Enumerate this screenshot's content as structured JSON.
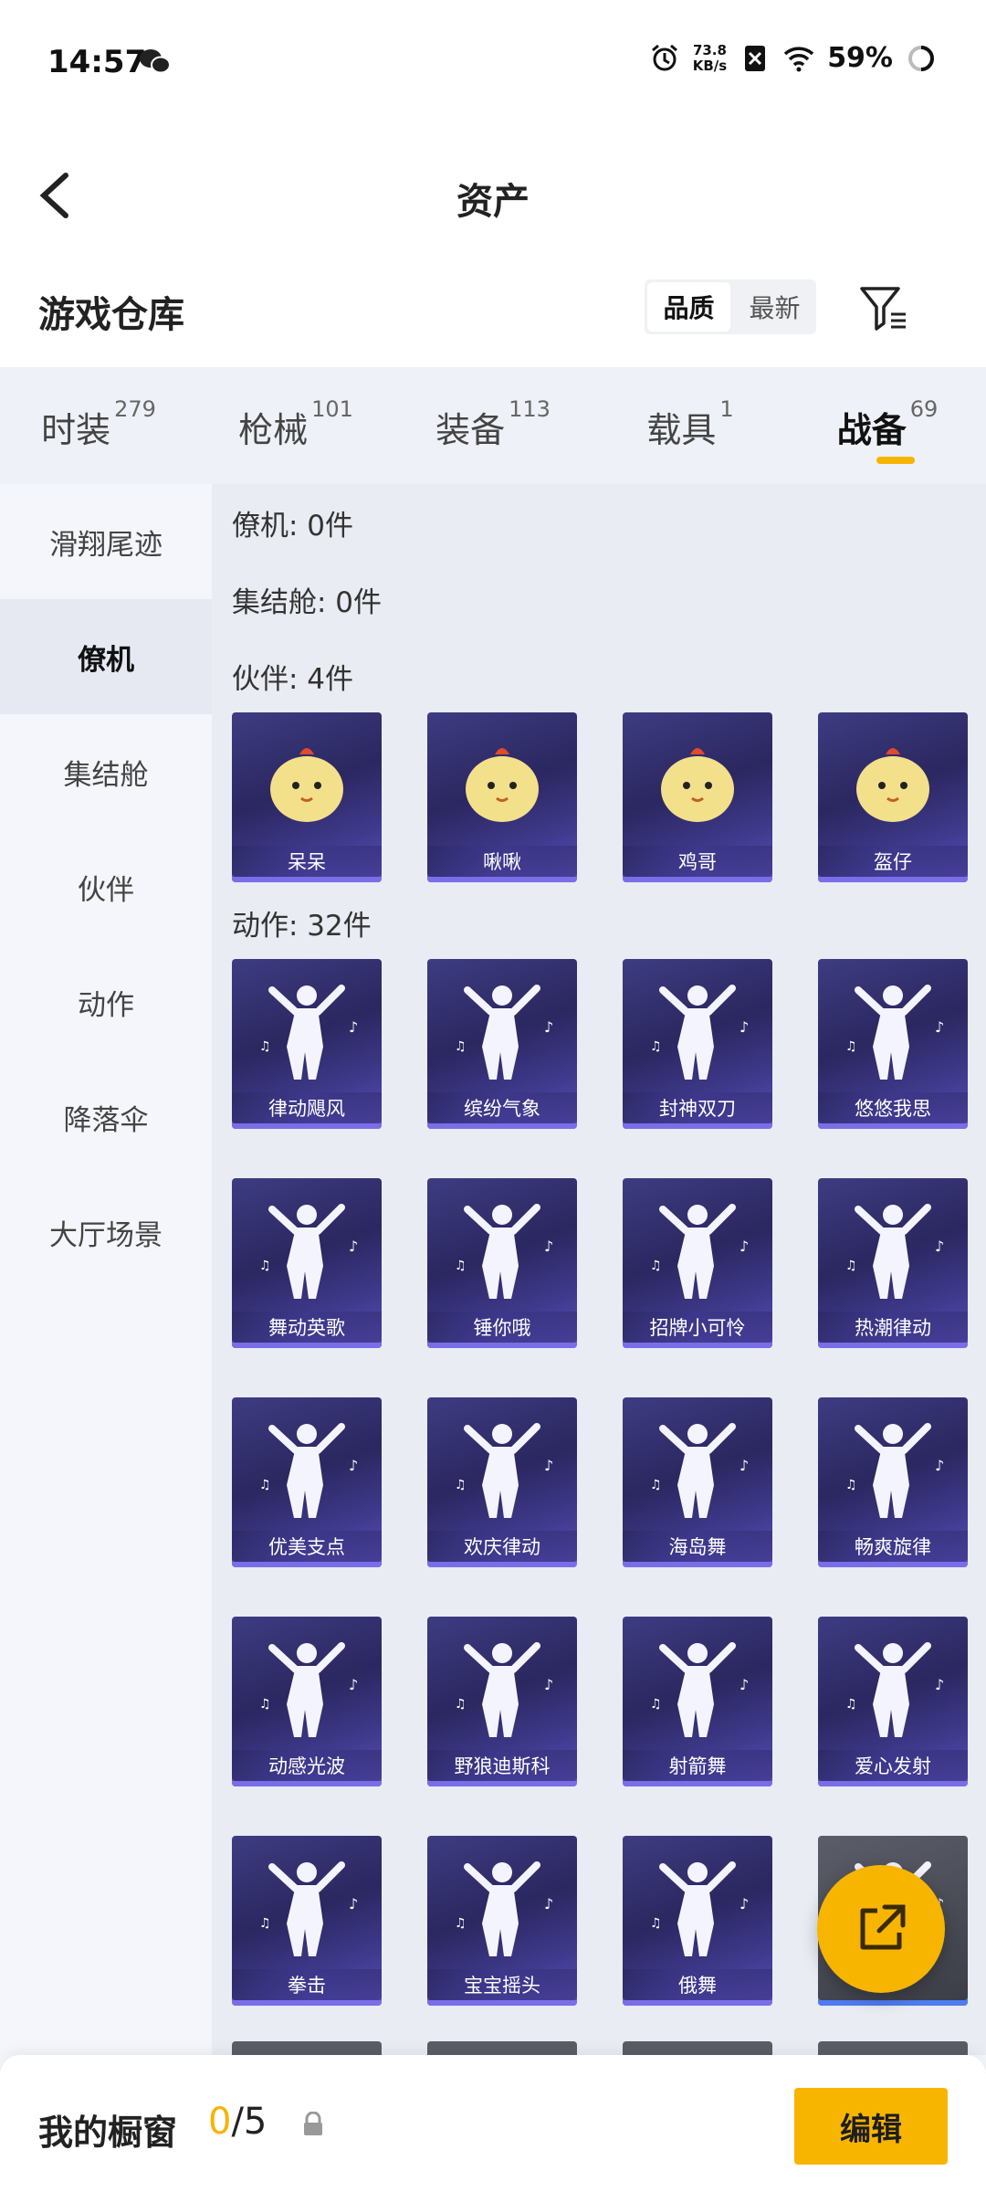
{
  "status_bar": {
    "time": "14:57",
    "speed_value": "73.8",
    "speed_unit": "KB/s",
    "battery": "59%"
  },
  "header": {
    "title": "资产"
  },
  "warehouse": {
    "title": "游戏仓库",
    "sort_quality": "品质",
    "sort_newest": "最新"
  },
  "tabs": [
    {
      "label": "时装",
      "count": "279"
    },
    {
      "label": "枪械",
      "count": "101"
    },
    {
      "label": "装备",
      "count": "113"
    },
    {
      "label": "载具",
      "count": "1"
    },
    {
      "label": "战备",
      "count": "69"
    }
  ],
  "sidebar": {
    "items": [
      "滑翔尾迹",
      "僚机",
      "集结舱",
      "伙伴",
      "动作",
      "降落伞",
      "大厅场景"
    ]
  },
  "sections": {
    "wingman": "僚机: 0件",
    "pod": "集结舱: 0件",
    "partner": "伙伴: 4件",
    "action": "动作: 32件"
  },
  "partners": [
    "呆呆",
    "啾啾",
    "鸡哥",
    "盔仔"
  ],
  "actions": [
    "律动飓风",
    "缤纷气象",
    "封神双刀",
    "悠悠我思",
    "舞动英歌",
    "锤你哦",
    "招牌小可怜",
    "热潮律动",
    "优美支点",
    "欢庆律动",
    "海岛舞",
    "畅爽旋律",
    "动感光波",
    "野狼迪斯科",
    "射箭舞",
    "爱心发射",
    "拳击",
    "宝宝摇头",
    "俄舞",
    ""
  ],
  "bottom": {
    "label": "我的橱窗",
    "count_current": "0",
    "count_total": "/5",
    "edit": "编辑"
  },
  "colors": {
    "accent": "#f7b500",
    "card": "#2b2760"
  }
}
